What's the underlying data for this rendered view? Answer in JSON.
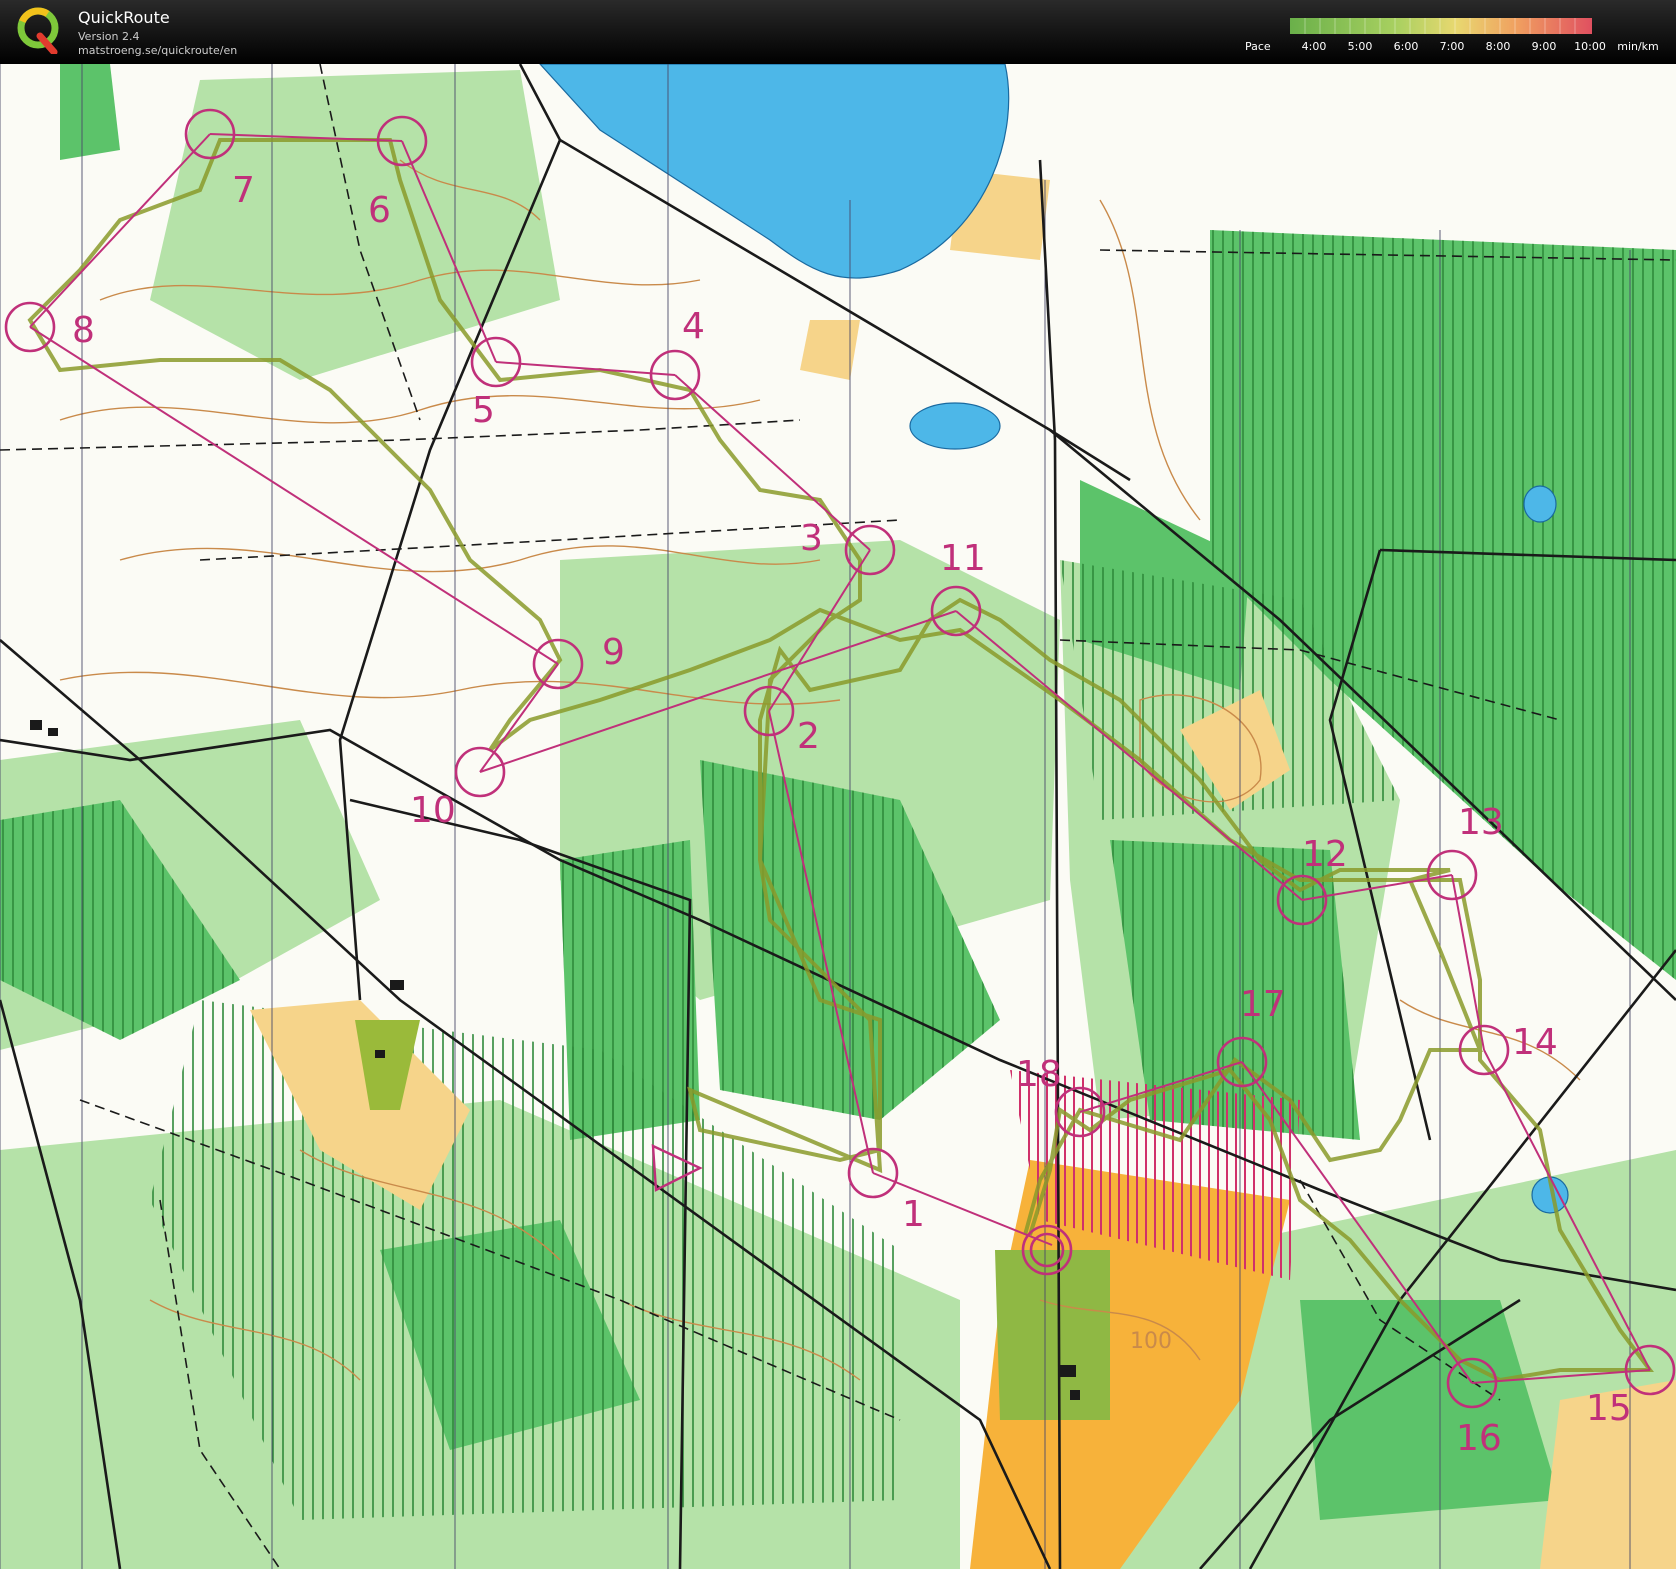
{
  "header": {
    "app_name": "QuickRoute",
    "version": "Version 2.4",
    "url": "matstroeng.se/quickroute/en",
    "logo_letter": "Q",
    "pace_label": "Pace",
    "pace_ticks": [
      "4:00",
      "5:00",
      "6:00",
      "7:00",
      "8:00",
      "9:00",
      "10:00"
    ],
    "pace_unit": "min/km"
  },
  "colors": {
    "forest_green": "#5cc36a",
    "light_green": "#a8e0a0",
    "open_yellow": "#f7c66a",
    "water_blue": "#4db7e8",
    "course_magenta": "#c0307a",
    "route_olive": "#8a9a2a",
    "contour_brown": "#c98a4a"
  },
  "controls": [
    {
      "label": "7"
    },
    {
      "label": "6"
    },
    {
      "label": "8"
    },
    {
      "label": "4"
    },
    {
      "label": "5"
    },
    {
      "label": "3"
    },
    {
      "label": "11"
    },
    {
      "label": "9"
    },
    {
      "label": "2"
    },
    {
      "label": "10"
    },
    {
      "label": "12"
    },
    {
      "label": "13"
    },
    {
      "label": "17"
    },
    {
      "label": "14"
    },
    {
      "label": "18"
    },
    {
      "label": "1"
    },
    {
      "label": "16"
    },
    {
      "label": "15"
    }
  ],
  "map_text": {
    "spot_height": "100"
  }
}
